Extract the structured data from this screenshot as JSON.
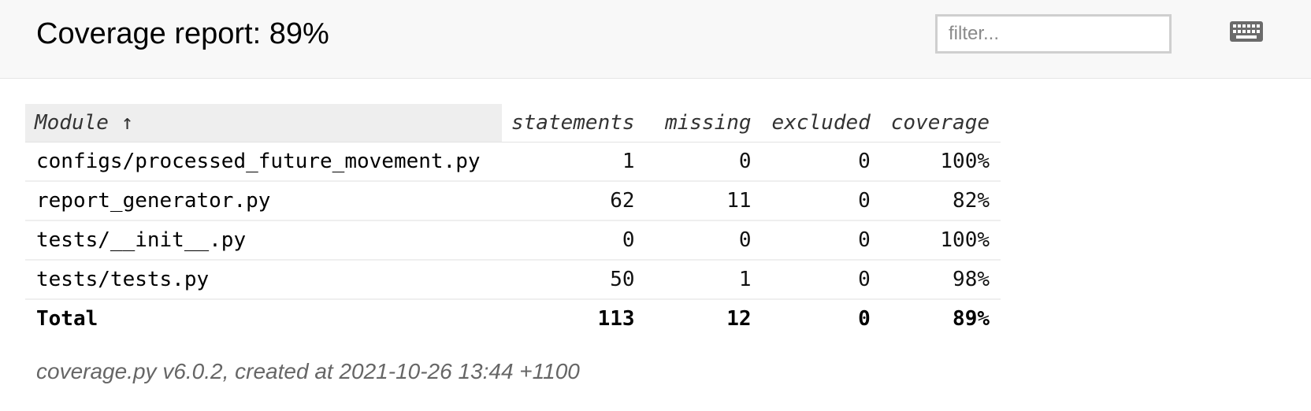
{
  "header": {
    "title": "Coverage report: 89%",
    "filter_placeholder": "filter...",
    "keyboard_icon": "keyboard-icon"
  },
  "table": {
    "columns": {
      "module": "Module ↑",
      "statements": "statements",
      "missing": "missing",
      "excluded": "excluded",
      "coverage": "coverage"
    },
    "rows": [
      {
        "module": "configs/processed_future_movement.py",
        "statements": "1",
        "missing": "0",
        "excluded": "0",
        "coverage": "100%"
      },
      {
        "module": "report_generator.py",
        "statements": "62",
        "missing": "11",
        "excluded": "0",
        "coverage": "82%"
      },
      {
        "module": "tests/__init__.py",
        "statements": "0",
        "missing": "0",
        "excluded": "0",
        "coverage": "100%"
      },
      {
        "module": "tests/tests.py",
        "statements": "50",
        "missing": "1",
        "excluded": "0",
        "coverage": "98%"
      }
    ],
    "total": {
      "module": "Total",
      "statements": "113",
      "missing": "12",
      "excluded": "0",
      "coverage": "89%"
    }
  },
  "footer": {
    "text": "coverage.py v6.0.2, created at 2021-10-26 13:44 +1100"
  },
  "colors": {
    "header_bg": "#f8f8f8",
    "sorted_column_bg": "#eeeeee",
    "footer_text": "#666666"
  }
}
